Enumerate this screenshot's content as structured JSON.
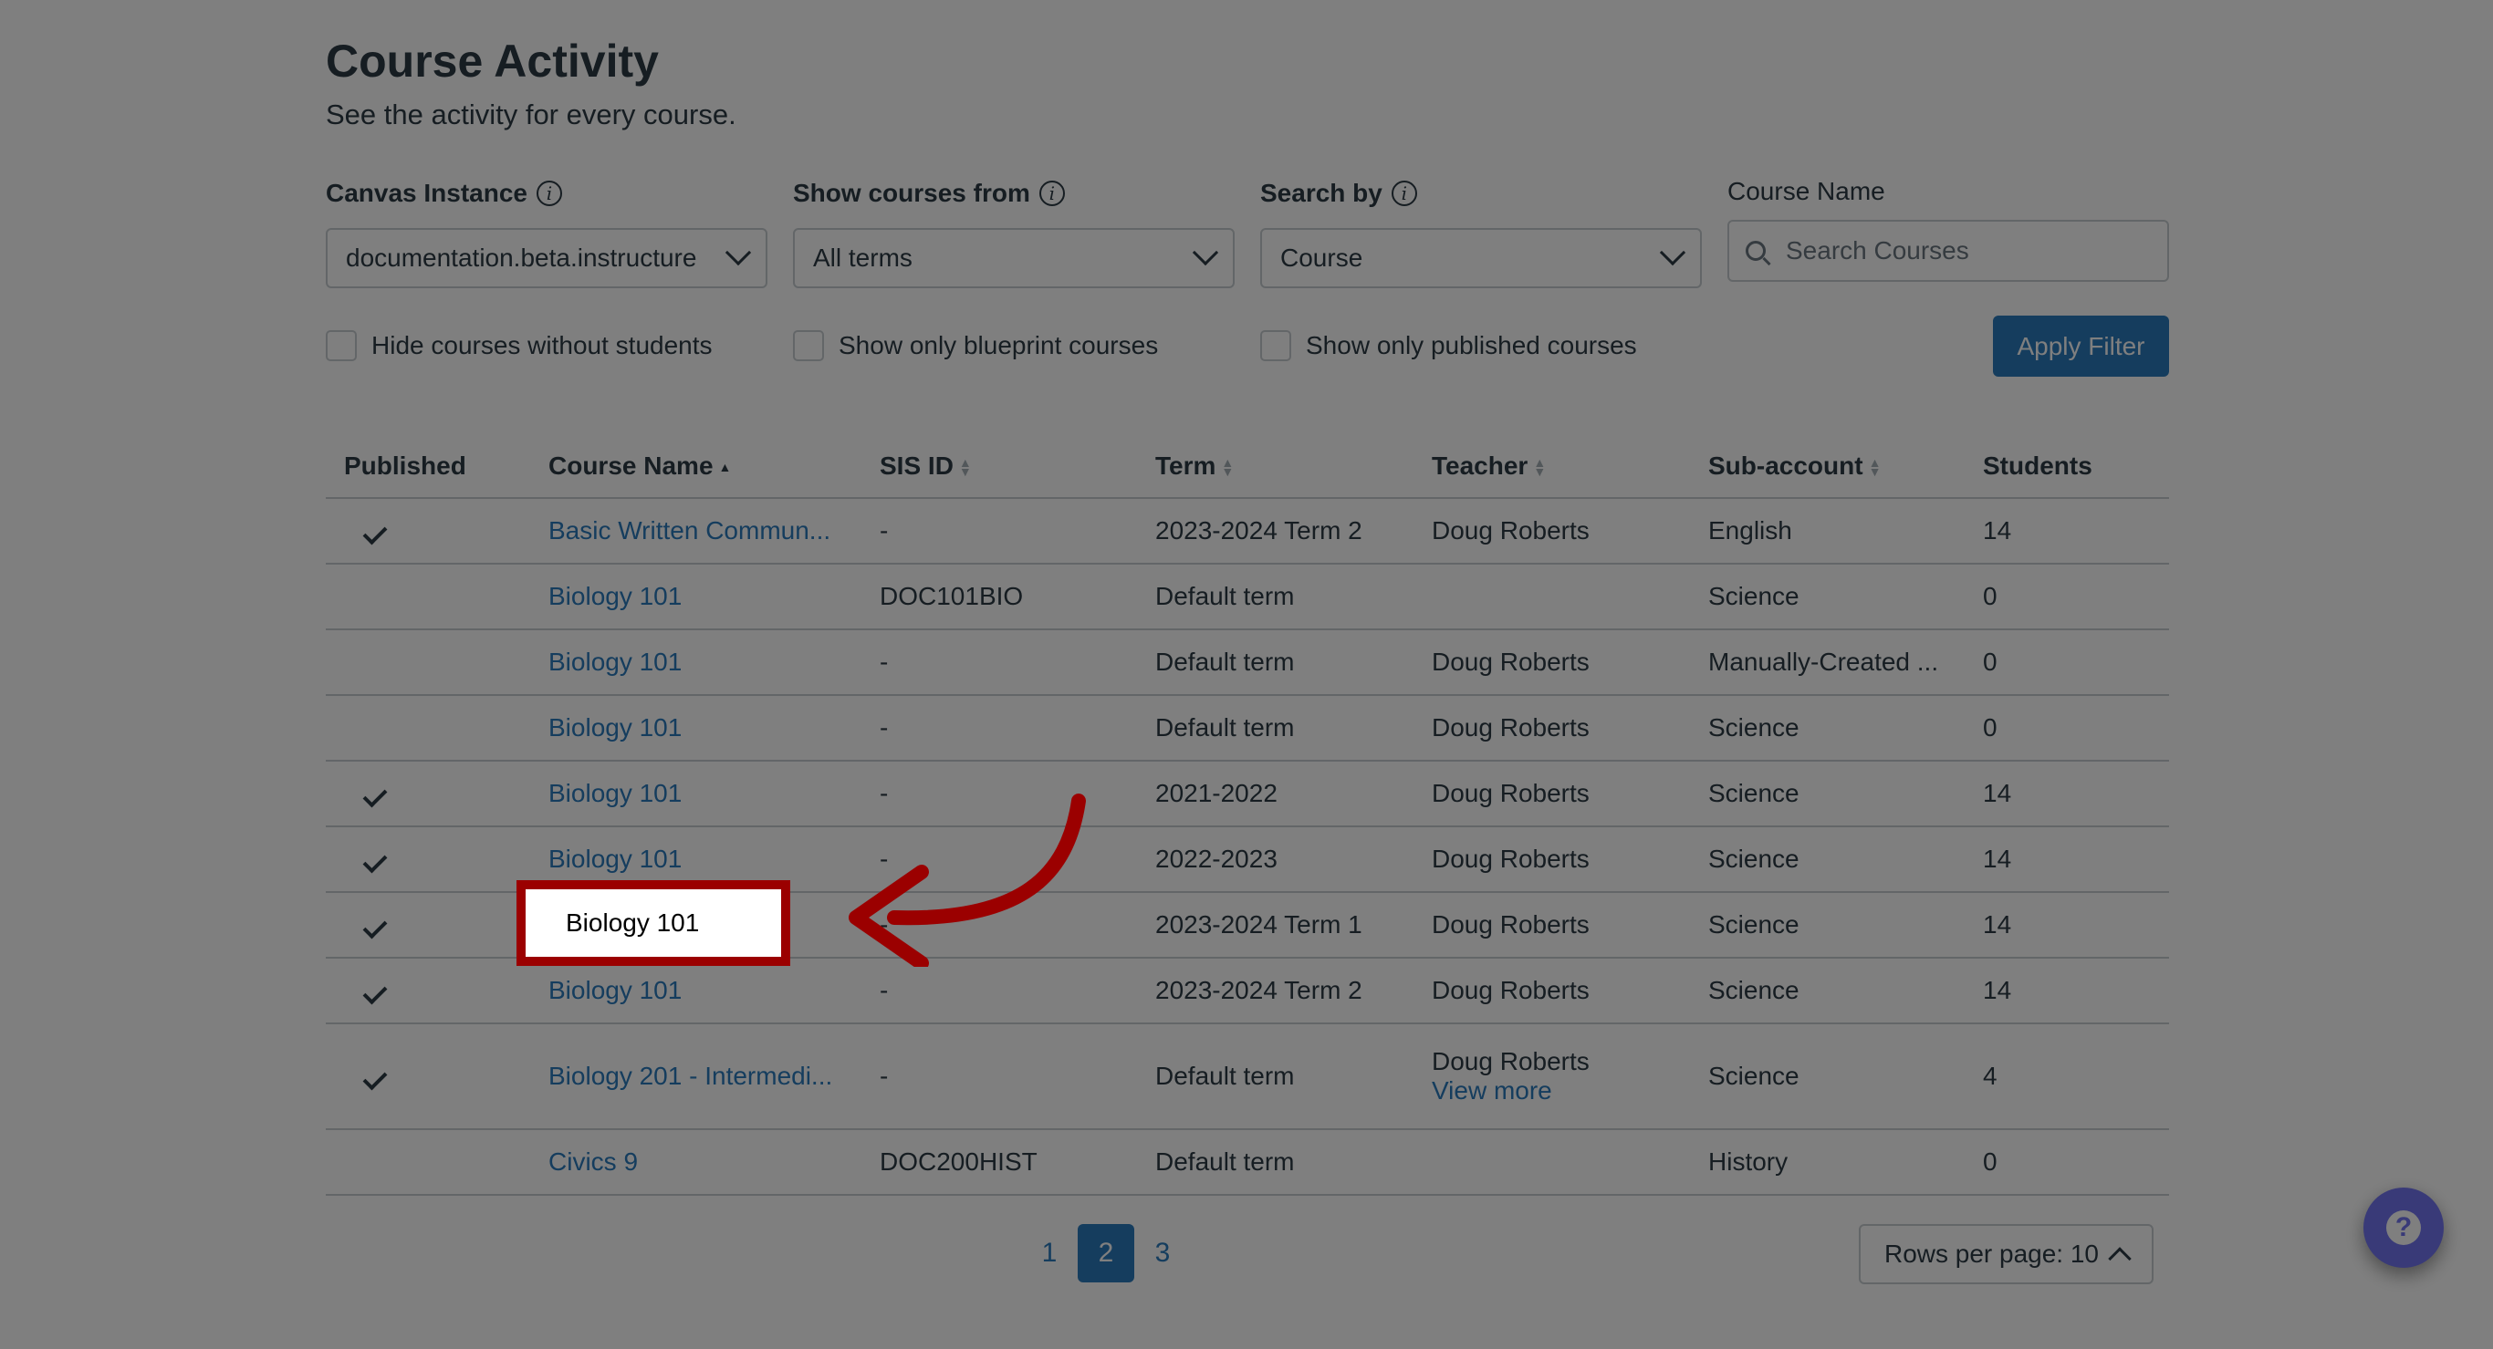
{
  "header": {
    "title": "Course Activity",
    "subtitle": "See the activity for every course."
  },
  "filters": {
    "canvas_instance": {
      "label": "Canvas Instance",
      "value": "documentation.beta.instructure"
    },
    "show_courses_from": {
      "label": "Show courses from",
      "value": "All terms"
    },
    "search_by": {
      "label": "Search by",
      "value": "Course"
    },
    "course_name": {
      "label": "Course Name",
      "placeholder": "Search Courses",
      "value": ""
    },
    "checkboxes": [
      {
        "label": "Hide courses without students",
        "checked": false
      },
      {
        "label": "Show only blueprint courses",
        "checked": false
      },
      {
        "label": "Show only published courses",
        "checked": false
      }
    ],
    "apply_label": "Apply Filter"
  },
  "table": {
    "columns": [
      {
        "label": "Published",
        "sortable": false
      },
      {
        "label": "Course Name",
        "sortable": true,
        "sort": "asc"
      },
      {
        "label": "SIS ID",
        "sortable": true
      },
      {
        "label": "Term",
        "sortable": true
      },
      {
        "label": "Teacher",
        "sortable": true
      },
      {
        "label": "Sub-account",
        "sortable": true
      },
      {
        "label": "Students",
        "sortable": false
      }
    ],
    "rows": [
      {
        "published": true,
        "course_name": "Basic Written Commun...",
        "sis_id": "-",
        "term": "2023-2024 Term 2",
        "teacher": "Doug Roberts",
        "sub_account": "English",
        "students": "14"
      },
      {
        "published": false,
        "course_name": "Biology 101",
        "sis_id": "DOC101BIO",
        "term": "Default term",
        "teacher": "",
        "sub_account": "Science",
        "students": "0"
      },
      {
        "published": false,
        "course_name": "Biology 101",
        "sis_id": "-",
        "term": "Default term",
        "teacher": "Doug Roberts",
        "sub_account": "Manually-Created ...",
        "students": "0"
      },
      {
        "published": false,
        "course_name": "Biology 101",
        "sis_id": "-",
        "term": "Default term",
        "teacher": "Doug Roberts",
        "sub_account": "Science",
        "students": "0"
      },
      {
        "published": true,
        "course_name": "Biology 101",
        "sis_id": "-",
        "term": "2021-2022",
        "teacher": "Doug Roberts",
        "sub_account": "Science",
        "students": "14"
      },
      {
        "published": true,
        "course_name": "Biology 101",
        "sis_id": "-",
        "term": "2022-2023",
        "teacher": "Doug Roberts",
        "sub_account": "Science",
        "students": "14"
      },
      {
        "published": true,
        "course_name": "Biology 101",
        "sis_id": "-",
        "term": "2023-2024 Term 1",
        "teacher": "Doug Roberts",
        "sub_account": "Science",
        "students": "14"
      },
      {
        "published": true,
        "course_name": "Biology 101",
        "sis_id": "-",
        "term": "2023-2024 Term 2",
        "teacher": "Doug Roberts",
        "sub_account": "Science",
        "students": "14"
      },
      {
        "published": true,
        "course_name": "Biology 201 - Intermedi...",
        "sis_id": "-",
        "term": "Default term",
        "teacher": "Doug Roberts",
        "teacher_more": "View more",
        "sub_account": "Science",
        "students": "4"
      },
      {
        "published": false,
        "course_name": "Civics 9",
        "sis_id": "DOC200HIST",
        "term": "Default term",
        "teacher": "",
        "sub_account": "History",
        "students": "0"
      }
    ]
  },
  "pagination": {
    "pages": [
      "1",
      "2",
      "3"
    ],
    "current": "2",
    "rows_per_page_label": "Rows per page: 10"
  },
  "callout": {
    "highlighted_text": "Biology 101",
    "highlight_color": "#9b0000"
  },
  "help_button": {
    "icon": "question-icon"
  }
}
